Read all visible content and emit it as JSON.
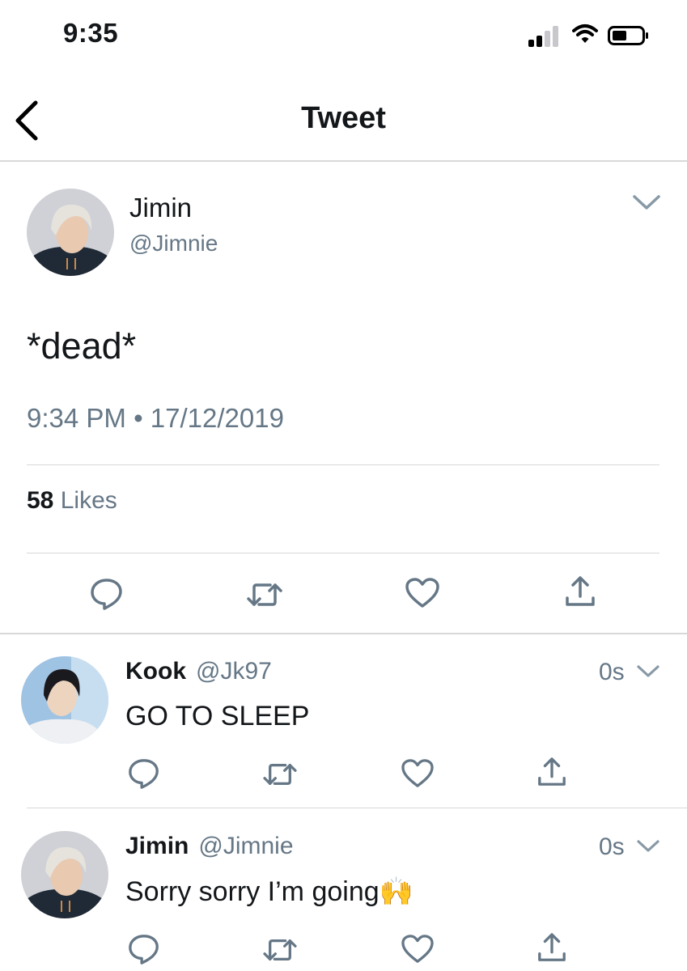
{
  "status_bar": {
    "time": "9:35"
  },
  "header": {
    "title": "Tweet"
  },
  "tweet": {
    "author_name": "Jimin",
    "author_handle": "@Jimnie",
    "text": "*dead*",
    "timestamp": "9:34 PM • 17/12/2019",
    "likes_count": "58",
    "likes_label": "Likes"
  },
  "replies": [
    {
      "name": "Kook",
      "handle": "@Jk97",
      "time": "0s",
      "text": "GO TO SLEEP"
    },
    {
      "name": "Jimin",
      "handle": "@Jimnie",
      "time": "0s",
      "text": "Sorry sorry I’m going",
      "emoji": "🙌"
    }
  ],
  "colors": {
    "secondary_text": "#657786",
    "icon": "#657786",
    "divider": "#d8d8d8"
  },
  "icons": [
    "back-chevron-icon",
    "chevron-down-icon",
    "reply-icon",
    "retweet-icon",
    "like-icon",
    "share-icon",
    "signal-icon",
    "wifi-icon",
    "battery-icon"
  ]
}
